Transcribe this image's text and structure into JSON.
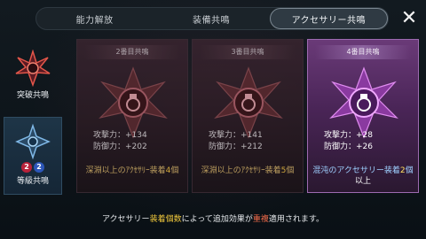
{
  "tabs": [
    {
      "label": "能力解放",
      "active": false
    },
    {
      "label": "装備共鳴",
      "active": false
    },
    {
      "label": "アクセサリー共鳴",
      "active": true
    }
  ],
  "sidebar": {
    "items": [
      {
        "label": "突破共鳴",
        "selected": false
      },
      {
        "label": "等級共鳴",
        "selected": true,
        "badges": [
          "2",
          "2"
        ]
      }
    ]
  },
  "cards": [
    {
      "title": "2番目共鳴",
      "attack": "攻撃力：+134",
      "defense": "防御力：+202",
      "cond_main": "深淵以上のｱｸｾｻﾘｰ装着",
      "cond_count": "4",
      "cond_unit": "個",
      "cond_tail": ""
    },
    {
      "title": "3番目共鳴",
      "attack": "攻撃力：+141",
      "defense": "防御力：+212",
      "cond_main": "深淵以上のｱｸｾｻﾘｰ装着",
      "cond_count": "5",
      "cond_unit": "個",
      "cond_tail": ""
    },
    {
      "title": "4番目共鳴",
      "attack": "攻撃力：+28",
      "defense": "防御力：+26",
      "cond_main": "混沌のアクセサリー装着",
      "cond_count": "2",
      "cond_unit": "個",
      "cond_tail": "以上"
    }
  ],
  "note": {
    "p1": "アクセサリー",
    "p2": "装着個数",
    "p3": "によって追加効果が",
    "p4": "重複",
    "p5": "適用されます。"
  },
  "colors": {
    "accent_yellow": "#f0c83c",
    "accent_red": "#f06a4a",
    "card_active": "#6a3a78"
  }
}
